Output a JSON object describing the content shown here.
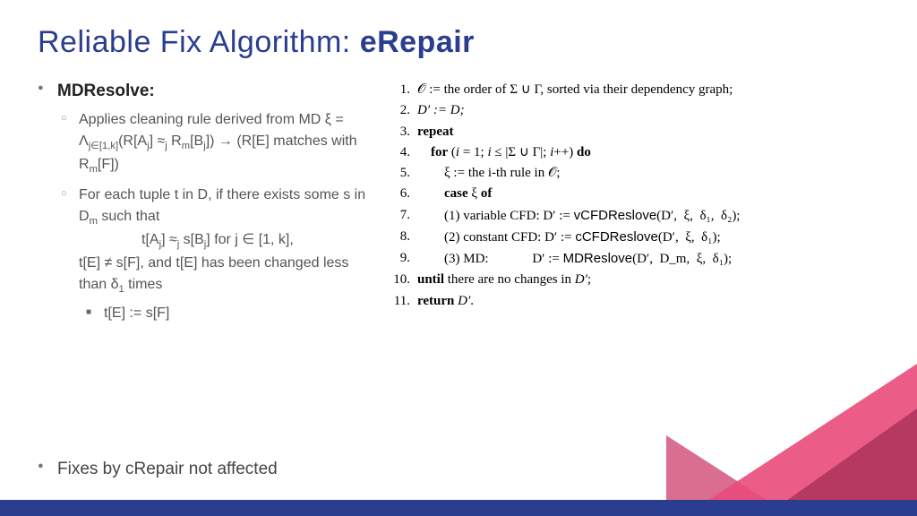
{
  "title_prefix": "Reliable Fix Algorithm: ",
  "title_bold": "eRepair",
  "left": {
    "heading": "MDResolve:",
    "b1a": "Applies cleaning rule derived from MD ξ = Λ",
    "b1a_sub": "j∈[1,k]",
    "b1b": "(R[A",
    "b1c": "] ≈",
    "b1d": " R",
    "b1e": "[B",
    "b1f": "]) → (R[E] matches with R",
    "b1g": "[F])",
    "b2a": "For each tuple t in D, if there exists some s in D",
    "b2b": " such that",
    "b2c": "t[A",
    "b2d": "] ≈",
    "b2e": " s[B",
    "b2f": "] for j ∈ [1, k],",
    "b2g": "t[E] ≠ s[F], and t[E] has been changed less than δ",
    "b2h": " times",
    "b3": "t[E] := s[F]",
    "fixes": "Fixes by cRepair not affected"
  },
  "algo": {
    "l1": "𝒪 := the order of Σ ∪ Γ, sorted via their dependency graph;",
    "l2": "D′ := D;",
    "l3": "repeat",
    "l4": "    for (i = 1; i ≤ |Σ ∪ Γ|; i++) do",
    "l5": "        ξ := the i-th rule in 𝒪;",
    "l6": "        case ξ of",
    "l7a": "        (1) variable CFD: D′ := ",
    "l7b": "vCFDReslove",
    "l7c": "(D′,  ξ,  δ₁,  δ₂);",
    "l8a": "        (2) constant CFD: D′ := ",
    "l8b": "cCFDReslove",
    "l8c": "(D′,  ξ,  δ₁);",
    "l9a": "        (3) MD:             D′ := ",
    "l9b": "MDReslove",
    "l9c": "(D′,  D_m,  ξ,  δ₁);",
    "l10": "until there are no changes in D′;",
    "l11": "return D′."
  }
}
